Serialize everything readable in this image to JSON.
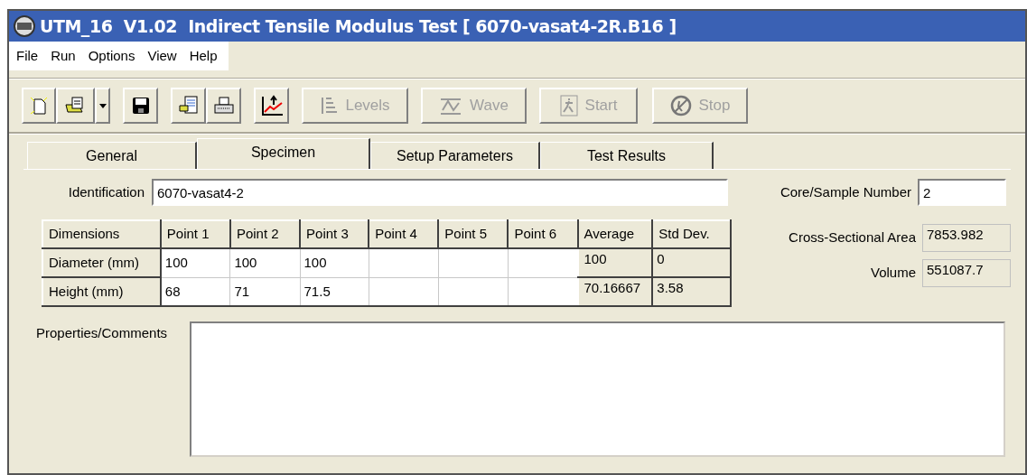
{
  "window": {
    "title": "UTM_16  V1.02  Indirect Tensile Modulus Test [ 6070-vasat4-2R.B16 ]"
  },
  "menu": [
    "File",
    "Run",
    "Options",
    "View",
    "Help"
  ],
  "toolbar": {
    "buttons": [
      {
        "label": "Levels",
        "kind": "levels",
        "disabled": true
      },
      {
        "label": "Wave",
        "kind": "wave",
        "disabled": true
      },
      {
        "label": "Start",
        "kind": "start",
        "disabled": true
      },
      {
        "label": "Stop",
        "kind": "stop",
        "disabled": true
      }
    ]
  },
  "tabs": [
    {
      "label": "General",
      "selected": false
    },
    {
      "label": "Specimen",
      "selected": true
    },
    {
      "label": "Setup Parameters",
      "selected": false
    },
    {
      "label": "Test Results",
      "selected": false
    }
  ],
  "specimen": {
    "identification": {
      "label": "Identification",
      "value": "6070-vasat4-2"
    },
    "core_sample_number": {
      "label": "Core/Sample Number",
      "value": "2"
    },
    "cross_sectional_area": {
      "label": "Cross-Sectional Area",
      "value": "7853.982"
    },
    "volume": {
      "label": "Volume",
      "value": "551087.7"
    },
    "table": {
      "columns": [
        "Dimensions",
        "Point 1",
        "Point 2",
        "Point 3",
        "Point 4",
        "Point 5",
        "Point 6",
        "Average",
        "Std Dev."
      ],
      "rows": [
        {
          "label": "Diameter (mm)",
          "points": [
            "100",
            "100",
            "100"
          ],
          "average": "100",
          "std_dev": "0"
        },
        {
          "label": "Height (mm)",
          "points": [
            "68",
            "71",
            "71.5"
          ],
          "average": "70.16667",
          "std_dev": "3.58"
        }
      ]
    },
    "comments": {
      "label": "Properties/Comments"
    }
  }
}
